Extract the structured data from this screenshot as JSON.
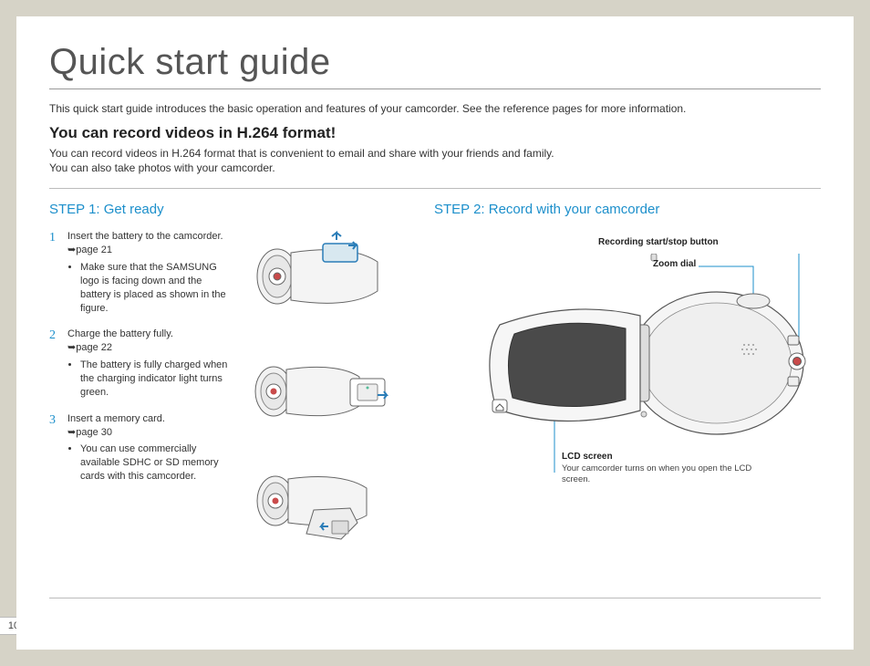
{
  "page_number": "10",
  "title": "Quick start guide",
  "intro": "This quick start guide introduces the basic operation and features of your camcorder. See the reference pages for more information.",
  "subhead": "You can record videos in H.264 format!",
  "subdesc_line1": "You can record videos in H.264 format that is convenient to email and share with your friends and family.",
  "subdesc_line2": "You can also take photos with your camcorder.",
  "step1": {
    "heading": "STEP 1: Get ready",
    "items": [
      {
        "num": "1",
        "text": "Insert the battery to the camcorder.",
        "ref": "page 21",
        "bullet": "Make sure that the SAMSUNG logo is facing down and the battery is placed as shown in the figure."
      },
      {
        "num": "2",
        "text": "Charge the battery fully.",
        "ref": "page 22",
        "bullet": "The battery is fully charged when the charging indicator light turns green."
      },
      {
        "num": "3",
        "text": "Insert a memory card.",
        "ref": "page 30",
        "bullet": "You can use commercially available SDHC or SD memory cards with this camcorder."
      }
    ]
  },
  "step2": {
    "heading": "STEP 2: Record with your camcorder",
    "labels": {
      "rec_button": "Recording start/stop button",
      "zoom": "Zoom dial",
      "lcd": "LCD screen",
      "lcd_sub": "Your camcorder turns on when you open the LCD screen."
    }
  }
}
